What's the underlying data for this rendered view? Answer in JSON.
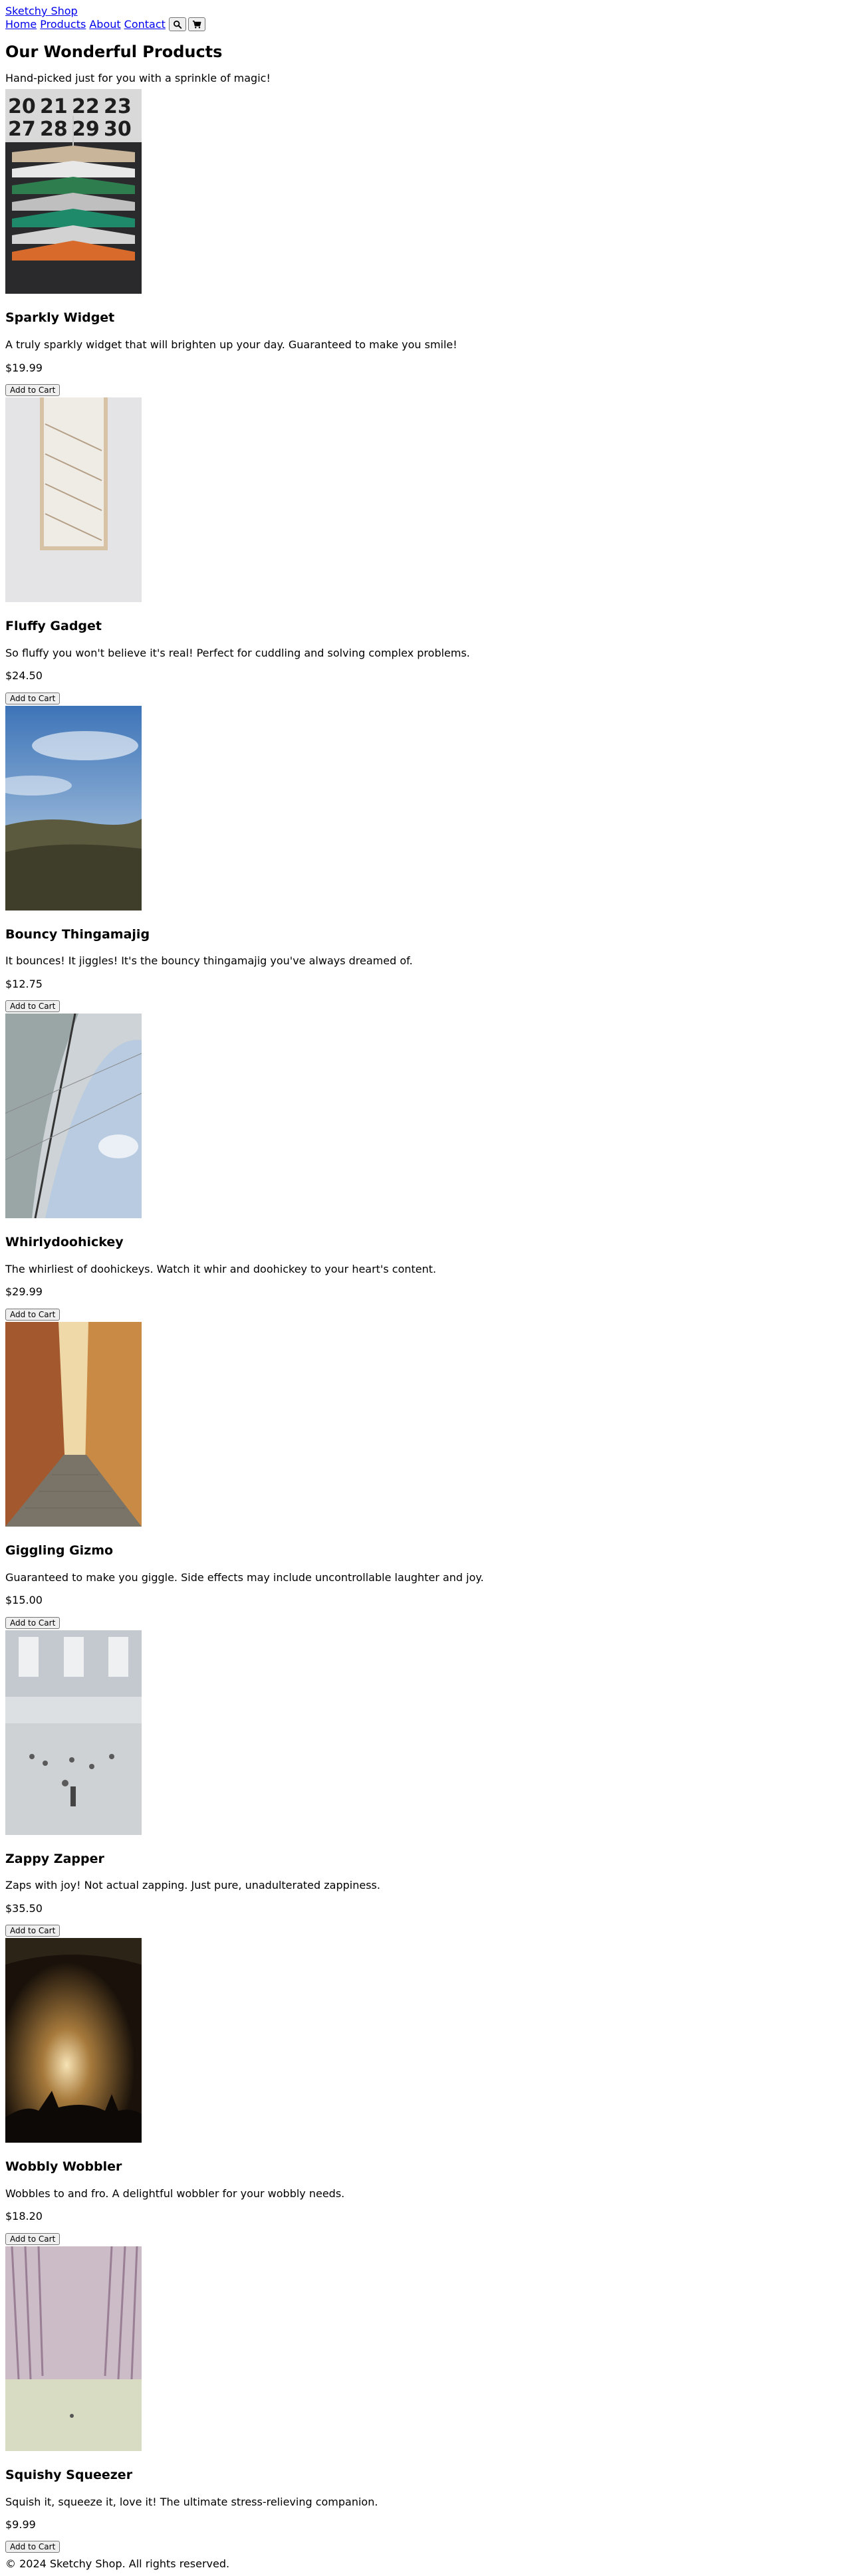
{
  "site": {
    "brand": "Sketchy Shop",
    "nav": [
      "Home",
      "Products",
      "About",
      "Contact"
    ],
    "icons": {
      "search": "search-icon",
      "cart": "cart-icon"
    }
  },
  "main": {
    "title": "Our Wonderful Products",
    "subtitle": "Hand-picked just for you with a sprinkle of magic!"
  },
  "products": [
    {
      "name": "Sparkly Widget",
      "desc": "A truly sparkly widget that will brighten up your day. Guaranteed to make you smile!",
      "price": "$19.99",
      "button": "Add to Cart"
    },
    {
      "name": "Fluffy Gadget",
      "desc": "So fluffy you won't believe it's real! Perfect for cuddling and solving complex problems.",
      "price": "$24.50",
      "button": "Add to Cart"
    },
    {
      "name": "Bouncy Thingamajig",
      "desc": "It bounces! It jiggles! It's the bouncy thingamajig you've always dreamed of.",
      "price": "$12.75",
      "button": "Add to Cart"
    },
    {
      "name": "Whirlydoohickey",
      "desc": "The whirliest of doohickeys. Watch it whir and doohickey to your heart's content.",
      "price": "$29.99",
      "button": "Add to Cart"
    },
    {
      "name": "Giggling Gizmo",
      "desc": "Guaranteed to make you giggle. Side effects may include uncontrollable laughter and joy.",
      "price": "$15.00",
      "button": "Add to Cart"
    },
    {
      "name": "Zappy Zapper",
      "desc": "Zaps with joy! Not actual zapping. Just pure, unadulterated zappiness.",
      "price": "$35.50",
      "button": "Add to Cart"
    },
    {
      "name": "Wobbly Wobbler",
      "desc": "Wobbles to and fro. A delightful wobbler for your wobbly needs.",
      "price": "$18.20",
      "button": "Add to Cart"
    },
    {
      "name": "Squishy Squeezer",
      "desc": "Squish it, squeeze it, love it! The ultimate stress-relieving companion.",
      "price": "$9.99",
      "button": "Add to Cart"
    }
  ],
  "calendar_numbers": [
    "20",
    "21",
    "22",
    "23",
    "27",
    "28",
    "29",
    "30"
  ],
  "footer": {
    "text": "© 2024 Sketchy Shop. All rights reserved."
  }
}
